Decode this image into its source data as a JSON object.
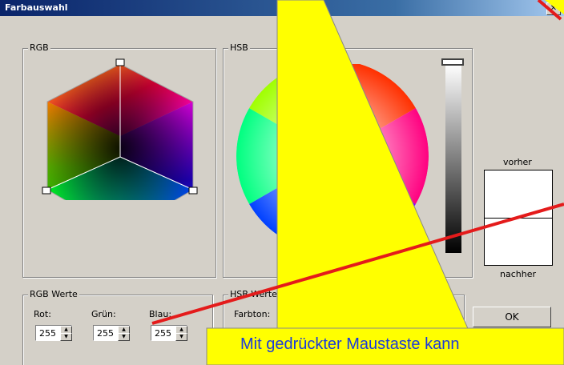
{
  "window": {
    "title": "Farbauswahl",
    "close_symbol": "✕"
  },
  "rgb_panel": {
    "title": "RGB"
  },
  "hsb_panel": {
    "title": "HSB"
  },
  "preview": {
    "before_label": "vorher",
    "after_label": "nachher"
  },
  "rgb_values": {
    "title": "RGB Werte",
    "fields": [
      {
        "label": "Rot:",
        "value": "255"
      },
      {
        "label": "Grün:",
        "value": "255"
      },
      {
        "label": "Blau:",
        "value": "255"
      }
    ]
  },
  "hsb_values": {
    "title": "HSB Werte",
    "hue_label": "Farbton:"
  },
  "buttons": {
    "ok": "OK"
  },
  "annotation": {
    "text": "Mit gedrückter Maustaste kann",
    "text_color": "#1a3adc",
    "callout_color": "#ffff00",
    "arrow_color": "#e41b1b"
  }
}
